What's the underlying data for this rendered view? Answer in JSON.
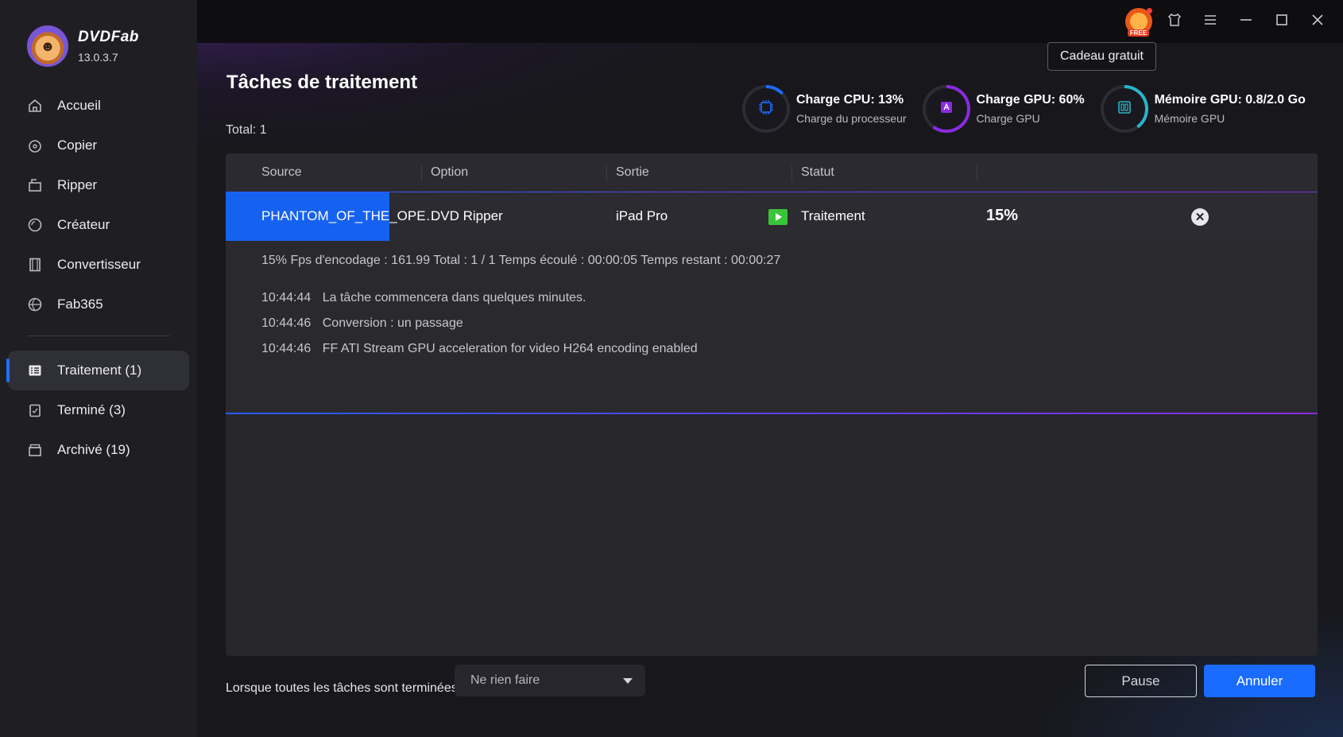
{
  "app": {
    "name": "DVDFab",
    "version": "13.0.3.7"
  },
  "sidebar": {
    "items": [
      {
        "label": "Accueil",
        "icon": "home-icon"
      },
      {
        "label": "Copier",
        "icon": "copy-disc-icon"
      },
      {
        "label": "Ripper",
        "icon": "ripper-icon"
      },
      {
        "label": "Créateur",
        "icon": "creator-disc-icon"
      },
      {
        "label": "Convertisseur",
        "icon": "film-icon"
      },
      {
        "label": "Fab365",
        "icon": "fab365-icon"
      }
    ],
    "task_items": [
      {
        "label": "Traitement (1)",
        "icon": "task-list-icon",
        "active": true
      },
      {
        "label": "Terminé (3)",
        "icon": "clipboard-check-icon",
        "active": false
      },
      {
        "label": "Archivé (19)",
        "icon": "archive-icon",
        "active": false
      }
    ]
  },
  "topbar": {
    "gift_badge": "FREE",
    "tooltip": "Cadeau gratuit"
  },
  "page": {
    "title": "Tâches de traitement",
    "total": "Total: 1"
  },
  "stats": [
    {
      "title": "Charge CPU: 13%",
      "subtitle": "Charge du processeur",
      "value": 13,
      "color": "#1e6bff",
      "icon": "cpu-icon"
    },
    {
      "title": "Charge GPU: 60%",
      "subtitle": "Charge GPU",
      "value": 60,
      "color": "#8a2be2",
      "icon": "amd-gpu-icon"
    },
    {
      "title": "Mémoire GPU: 0.8/2.0 Go",
      "subtitle": "Mémoire GPU",
      "value": 40,
      "color": "#2bb5c8",
      "icon": "memory-chip-icon"
    }
  ],
  "table": {
    "headers": {
      "source": "Source",
      "option": "Option",
      "output": "Sortie",
      "status": "Statut"
    },
    "row": {
      "source": "PHANTOM_OF_THE_OPE…",
      "option": "DVD Ripper",
      "output": "iPad Pro",
      "status": "Traitement",
      "percent": "15%",
      "progress": 0.15
    },
    "details": {
      "summary": "15%  Fps d'encodage : 161.99   Total : 1 / 1   Temps écoulé : 00:00:05   Temps restant : 00:00:27",
      "log": [
        {
          "time": "10:44:44",
          "message": "La tâche commencera dans quelques minutes."
        },
        {
          "time": "10:44:46",
          "message": "Conversion : un passage"
        },
        {
          "time": "10:44:46",
          "message": "FF ATI Stream GPU acceleration for video H264 encoding enabled"
        }
      ]
    }
  },
  "footer": {
    "label": "Lorsque toutes les tâches sont terminées :",
    "select_value": "Ne rien faire",
    "pause_label": "Pause",
    "cancel_label": "Annuler"
  }
}
